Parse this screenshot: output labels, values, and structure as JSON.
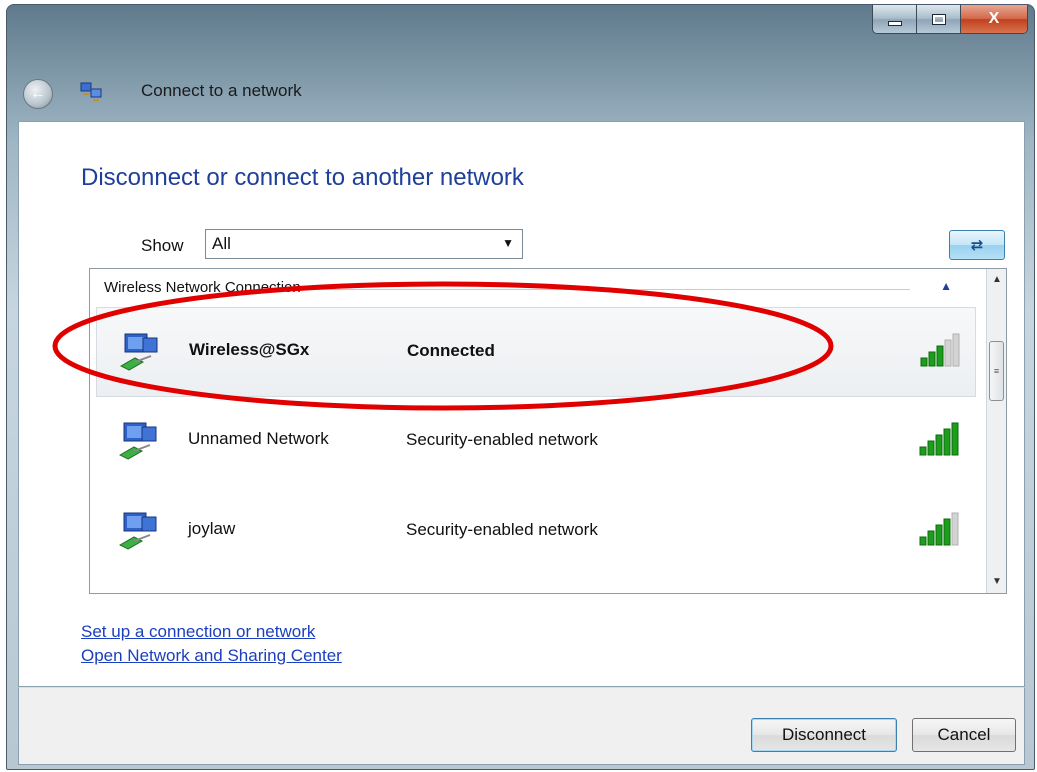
{
  "window": {
    "title": "Connect to a network",
    "caption": {
      "minimize": "minimize",
      "maximize": "maximize",
      "close": "X"
    }
  },
  "heading": "Disconnect or connect to another network",
  "filter": {
    "label": "Show",
    "selected": "All"
  },
  "list": {
    "group": "Wireless Network Connection",
    "networks": [
      {
        "name": "Wireless@SGx",
        "status": "Connected",
        "signal_bars": 2,
        "selected": true
      },
      {
        "name": "Unnamed Network",
        "status": "Security-enabled network",
        "signal_bars": 4,
        "selected": false
      },
      {
        "name": "joylaw",
        "status": "Security-enabled network",
        "signal_bars": 3,
        "selected": false
      }
    ]
  },
  "links": {
    "setup": "Set up a connection or network",
    "sharing_center": "Open Network and Sharing Center"
  },
  "buttons": {
    "disconnect": "Disconnect",
    "cancel": "Cancel"
  },
  "colors": {
    "heading": "#1e3f9a",
    "link": "#1a3fbf",
    "signal_on": "#1b9e1b",
    "annotation": "#e00000"
  }
}
